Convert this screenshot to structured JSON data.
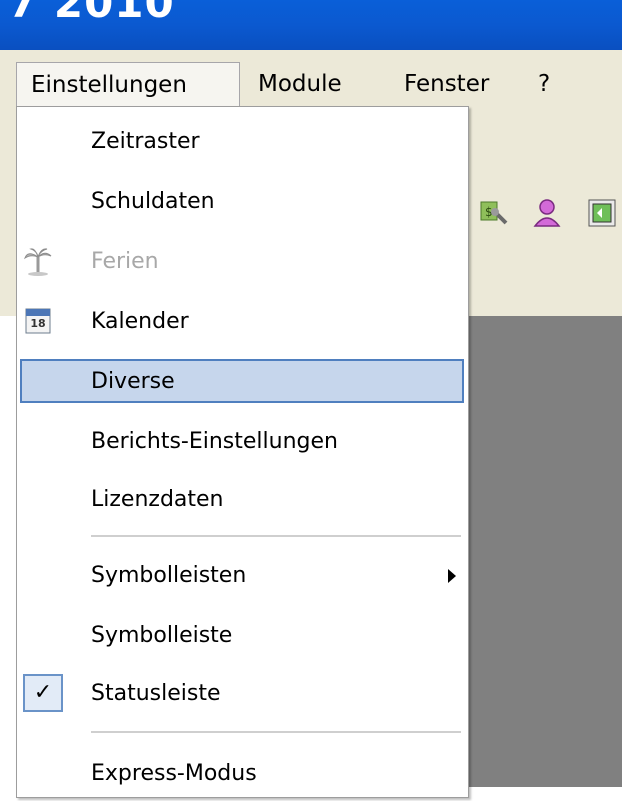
{
  "window": {
    "title_fragment": "7 2010"
  },
  "menubar": {
    "items": [
      {
        "label": "Einstellungen"
      },
      {
        "label": "Module"
      },
      {
        "label": "Fenster"
      },
      {
        "label": "?"
      }
    ]
  },
  "toolbar": {
    "icons": [
      "tools-icon",
      "user-icon",
      "document-icon"
    ]
  },
  "menu": {
    "items": [
      {
        "label": "Zeitraster"
      },
      {
        "label": "Schuldaten"
      },
      {
        "label": "Ferien",
        "icon": "palm-tree-icon",
        "disabled": true
      },
      {
        "label": "Kalender",
        "icon": "calendar-icon",
        "icon_text": "18"
      },
      {
        "label": "Diverse",
        "highlighted": true
      },
      {
        "label": "Berichts-Einstellungen"
      },
      {
        "label": "Lizenzdaten"
      },
      {
        "label": "Symbolleisten",
        "submenu": true
      },
      {
        "label": "Symbolleiste"
      },
      {
        "label": "Statusleiste",
        "checked": true,
        "check_glyph": "✓"
      },
      {
        "label": "Express-Modus"
      }
    ]
  },
  "colors": {
    "titlebar": "#0b59d0",
    "menubar_bg": "#ece9d8",
    "highlight_bg": "#c6d6ec",
    "highlight_border": "#4f7fbf",
    "workspace": "#808080"
  }
}
